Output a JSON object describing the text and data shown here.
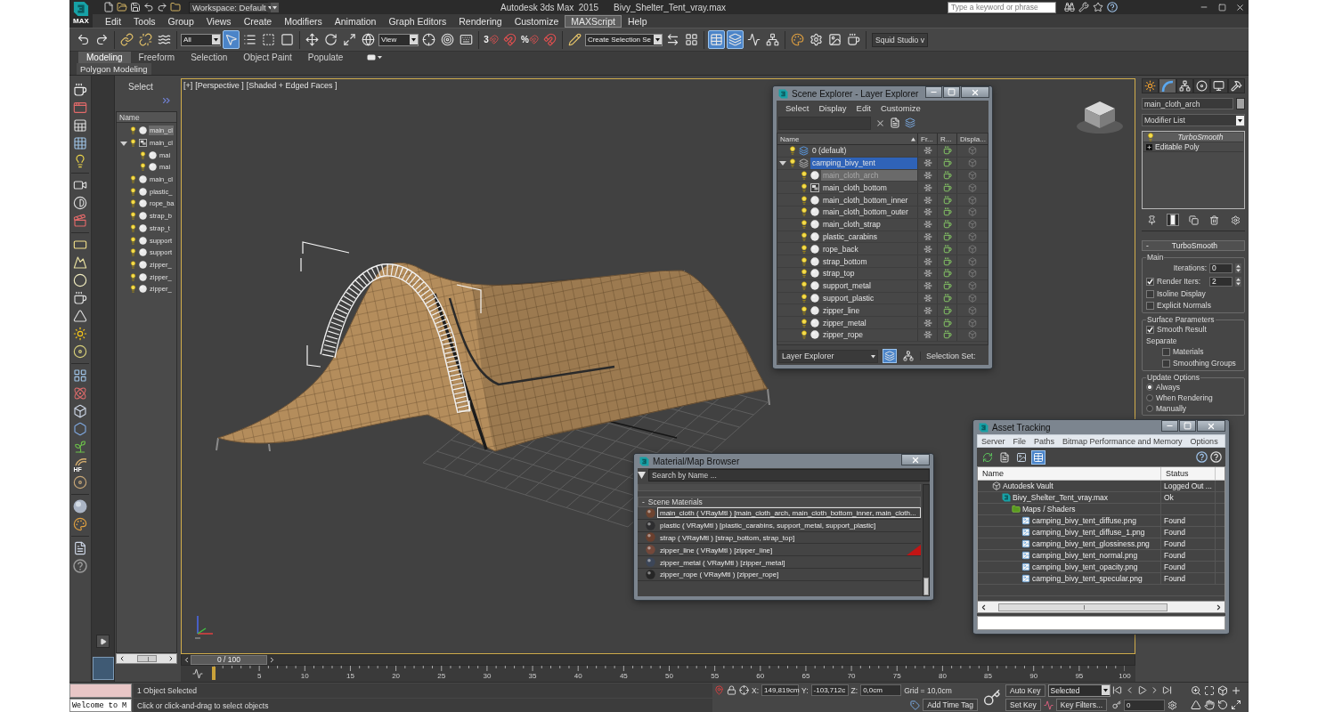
{
  "title_bar": {
    "logo_text": "MAX",
    "workspace": "Workspace: Default",
    "app_title": "Autodesk 3ds Max  2015",
    "file_name": "Bivy_Shelter_Tent_vray.max",
    "search": {
      "placeholder": "Type a keyword or phrase"
    }
  },
  "menu": [
    {
      "label": "Edit",
      "selected": false
    },
    {
      "label": "Tools",
      "selected": false
    },
    {
      "label": "Group",
      "selected": false
    },
    {
      "label": "Views",
      "selected": false
    },
    {
      "label": "Create",
      "selected": false
    },
    {
      "label": "Modifiers",
      "selected": false
    },
    {
      "label": "Animation",
      "selected": false
    },
    {
      "label": "Graph Editors",
      "selected": false
    },
    {
      "label": "Rendering",
      "selected": false
    },
    {
      "label": "Customize",
      "selected": false
    },
    {
      "label": "MAXScript",
      "selected": true
    },
    {
      "label": "Help",
      "selected": false
    }
  ],
  "main_toolbar": [
    {
      "kind": "undo",
      "pressed": false
    },
    {
      "kind": "redo",
      "pressed": false
    },
    {
      "kind": "separator"
    },
    {
      "kind": "link",
      "pressed": false
    },
    {
      "kind": "unlink",
      "pressed": false
    },
    {
      "kind": "bind",
      "pressed": false
    },
    {
      "kind": "separator"
    },
    {
      "kind": "dropdown",
      "value": "All"
    },
    {
      "kind": "select",
      "pressed": true
    },
    {
      "kind": "select_by_name",
      "pressed": false
    },
    {
      "kind": "region",
      "pressed": false
    },
    {
      "kind": "window",
      "pressed": false
    },
    {
      "kind": "separator"
    },
    {
      "kind": "move",
      "pressed": false
    },
    {
      "kind": "rotate",
      "pressed": false
    },
    {
      "kind": "scale",
      "pressed": false
    },
    {
      "kind": "place",
      "pressed": false
    },
    {
      "kind": "dropdown",
      "value": "View"
    },
    {
      "kind": "pivot",
      "pressed": false
    },
    {
      "kind": "manipulate",
      "pressed": false
    },
    {
      "kind": "keyboard",
      "pressed": false
    },
    {
      "kind": "separator"
    },
    {
      "kind": "snap",
      "label": "3",
      "pressed": false
    },
    {
      "kind": "angle_snap",
      "pressed": false
    },
    {
      "kind": "snap",
      "label": "%",
      "pressed": false
    },
    {
      "kind": "spinner_snap",
      "pressed": false
    },
    {
      "kind": "separator"
    },
    {
      "kind": "named_selection",
      "pressed": false
    },
    {
      "kind": "dropdown",
      "value": "Create Selection Se"
    },
    {
      "kind": "mirror",
      "pressed": false
    },
    {
      "kind": "align",
      "pressed": false
    },
    {
      "kind": "separator"
    },
    {
      "kind": "scene_explorer",
      "pressed": true
    },
    {
      "kind": "layer_explorer",
      "pressed": true
    },
    {
      "kind": "curve_editor",
      "pressed": false
    },
    {
      "kind": "schematic",
      "pressed": false
    },
    {
      "kind": "separator"
    },
    {
      "kind": "material_editor",
      "pressed": false
    },
    {
      "kind": "render_setup",
      "pressed": false
    },
    {
      "kind": "rendered_frame",
      "pressed": false
    },
    {
      "kind": "render",
      "pressed": false
    },
    {
      "kind": "separator"
    },
    {
      "kind": "label",
      "value": "Squid Studio v"
    }
  ],
  "ribbon": {
    "tabs": [
      {
        "label": "Modeling",
        "selected": true
      },
      {
        "label": "Freeform",
        "selected": false
      },
      {
        "label": "Selection",
        "selected": false
      },
      {
        "label": "Object Paint",
        "selected": false
      },
      {
        "label": "Populate",
        "selected": false
      }
    ],
    "panel_title": "Polygon Modeling"
  },
  "command_toolbar": {
    "hair_label": "HF"
  },
  "scene_panel": {
    "title": "Select",
    "column": "Name",
    "rows": [
      {
        "name": "main_cl",
        "kind": "object",
        "selected": true
      },
      {
        "name": "main_cl",
        "kind": "group",
        "selected": false,
        "expanded": true,
        "children": [
          {
            "name": "mai",
            "kind": "object",
            "selected": false
          },
          {
            "name": "mai",
            "kind": "object",
            "selected": false
          }
        ]
      },
      {
        "name": "main_cl",
        "kind": "object",
        "selected": false
      },
      {
        "name": "plastic_",
        "kind": "object",
        "selected": false
      },
      {
        "name": "rope_ba",
        "kind": "object",
        "selected": false
      },
      {
        "name": "strap_b",
        "kind": "object",
        "selected": false
      },
      {
        "name": "strap_t",
        "kind": "object",
        "selected": false
      },
      {
        "name": "support",
        "kind": "object",
        "selected": false
      },
      {
        "name": "support",
        "kind": "object",
        "selected": false
      },
      {
        "name": "zipper_",
        "kind": "object",
        "selected": false
      },
      {
        "name": "zipper_",
        "kind": "object",
        "selected": false
      },
      {
        "name": "zipper_",
        "kind": "object",
        "selected": false
      }
    ]
  },
  "viewport": {
    "active": true,
    "labels": [
      "[+]",
      "[Perspective ]",
      "[Shaded + Edged Faces ]"
    ]
  },
  "scene_explorer": {
    "title": "Scene Explorer - Layer Explorer",
    "menu": [
      "Select",
      "Display",
      "Edit",
      "Customize"
    ],
    "columns": [
      {
        "label": "Name",
        "sorted": true
      },
      {
        "label": "Fr...",
        "sorted": false
      },
      {
        "label": "R...",
        "sorted": false
      },
      {
        "label": "Displa...",
        "sorted": false
      }
    ],
    "layers": [
      {
        "name": "0 (default)",
        "kind": "layer",
        "current": true,
        "selected": false
      },
      {
        "name": "camping_bivy_tent",
        "kind": "layer",
        "current": false,
        "selected": true,
        "expanded": true,
        "children": [
          {
            "name": "main_cloth_arch",
            "kind": "object",
            "selected": true
          },
          {
            "name": "main_cloth_bottom",
            "kind": "group",
            "selected": false
          },
          {
            "name": "main_cloth_bottom_inner",
            "kind": "object",
            "selected": false
          },
          {
            "name": "main_cloth_bottom_outer",
            "kind": "object",
            "selected": false
          },
          {
            "name": "main_cloth_strap",
            "kind": "object",
            "selected": false
          },
          {
            "name": "plastic_carabins",
            "kind": "object",
            "selected": false
          },
          {
            "name": "rope_back",
            "kind": "object",
            "selected": false
          },
          {
            "name": "strap_bottom",
            "kind": "object",
            "selected": false
          },
          {
            "name": "strap_top",
            "kind": "object",
            "selected": false
          },
          {
            "name": "support_metal",
            "kind": "object",
            "selected": false
          },
          {
            "name": "support_plastic",
            "kind": "object",
            "selected": false
          },
          {
            "name": "zipper_line",
            "kind": "object",
            "selected": false
          },
          {
            "name": "zipper_metal",
            "kind": "object",
            "selected": false
          },
          {
            "name": "zipper_rope",
            "kind": "object",
            "selected": false
          }
        ]
      }
    ],
    "footer": {
      "mode": "Layer Explorer",
      "view_buttons": [
        {
          "kind": "layers",
          "pressed": true
        },
        {
          "kind": "hierarchy",
          "pressed": false
        }
      ],
      "selection_set": "Selection Set:"
    }
  },
  "material_browser": {
    "title": "Material/Map Browser",
    "search": {
      "placeholder": "Search by Name ..."
    },
    "group": {
      "toggle": "-",
      "label": "Scene Materials"
    },
    "materials": [
      {
        "label": "main_cloth ( VRayMtl ) [main_cloth_arch, main_cloth_bottom_inner, main_cloth...",
        "color": "#6e4430",
        "selected": true,
        "in_viewport": false
      },
      {
        "label": "plastic ( VRayMtl ) [plastic_carabins, support_metal, support_plastic]",
        "color": "#2e2e30",
        "selected": false,
        "in_viewport": false
      },
      {
        "label": "strap ( VRayMtl ) [strap_bottom, strap_top]",
        "color": "#6a3f2e",
        "selected": false,
        "in_viewport": false
      },
      {
        "label": "zipper_line ( VRayMtl ) [zipper_line]",
        "color": "#73483a",
        "selected": false,
        "in_viewport": true
      },
      {
        "label": "zipper_metal ( VRayMtl ) [zipper_metal]",
        "color": "#3c4658",
        "selected": false,
        "in_viewport": false
      },
      {
        "label": "zipper_rope ( VRayMtl ) [zipper_rope]",
        "color": "#262626",
        "selected": false,
        "in_viewport": false
      }
    ]
  },
  "asset_tracking": {
    "title": "Asset Tracking",
    "menu": [
      "Server",
      "File",
      "Paths",
      "Bitmap Performance and Memory",
      "Options"
    ],
    "view_buttons": [
      {
        "kind": "refresh",
        "pressed": false
      },
      {
        "kind": "list",
        "pressed": false
      },
      {
        "kind": "thumbnails",
        "pressed": false
      },
      {
        "kind": "table",
        "pressed": true
      }
    ],
    "columns": [
      "Name",
      "Status"
    ],
    "assets": [
      {
        "name": "Autodesk Vault",
        "status": "Logged Out ...",
        "kind": "vault",
        "children": [
          {
            "name": "Bivy_Shelter_Tent_vray.max",
            "status": "Ok",
            "kind": "scene",
            "children": [
              {
                "name": "Maps / Shaders",
                "kind": "folder",
                "children": [
                  {
                    "name": "camping_bivy_tent_diffuse.png",
                    "status": "Found",
                    "kind": "bitmap"
                  },
                  {
                    "name": "camping_bivy_tent_diffuse_1.png",
                    "status": "Found",
                    "kind": "bitmap"
                  },
                  {
                    "name": "camping_bivy_tent_glossiness.png",
                    "status": "Found",
                    "kind": "bitmap"
                  },
                  {
                    "name": "camping_bivy_tent_normal.png",
                    "status": "Found",
                    "kind": "bitmap"
                  },
                  {
                    "name": "camping_bivy_tent_opacity.png",
                    "status": "Found",
                    "kind": "bitmap"
                  },
                  {
                    "name": "camping_bivy_tent_specular.png",
                    "status": "Found",
                    "kind": "bitmap"
                  }
                ]
              }
            ]
          }
        ]
      }
    ]
  },
  "command_panel": {
    "tabs": [
      {
        "kind": "create",
        "selected": false
      },
      {
        "kind": "modify",
        "selected": true
      },
      {
        "kind": "hierarchy",
        "selected": false
      },
      {
        "kind": "motion",
        "selected": false
      },
      {
        "kind": "display",
        "selected": false
      },
      {
        "kind": "utilities",
        "selected": false
      }
    ],
    "object": {
      "name": "main_cloth_arch",
      "color": "#a3a3a3"
    },
    "modifier_list": "Modifier List",
    "stack": [
      {
        "name": "TurboSmooth",
        "kind": "modifier",
        "selected": true
      },
      {
        "name": "Editable Poly",
        "kind": "base",
        "selected": false
      }
    ],
    "stack_tools": [
      {
        "kind": "pin",
        "pressed": false
      },
      {
        "kind": "end_result",
        "pressed": true
      },
      {
        "kind": "make_unique",
        "pressed": false
      },
      {
        "kind": "remove",
        "pressed": false
      },
      {
        "kind": "configure",
        "pressed": false
      }
    ],
    "rollout": {
      "toggle": "-",
      "title": "TurboSmooth",
      "groups": [
        {
          "title": "Main",
          "controls": [
            {
              "kind": "spinner",
              "label": "Iterations:",
              "value": "0"
            },
            {
              "kind": "check_spinner",
              "label": "Render Iters:",
              "value": "2",
              "checked": true
            },
            {
              "kind": "checkbox",
              "label": "Isoline Display",
              "checked": false
            },
            {
              "kind": "checkbox",
              "label": "Explicit Normals",
              "checked": false
            }
          ]
        },
        {
          "title": "Surface Parameters",
          "controls": [
            {
              "kind": "checkbox",
              "label": "Smooth Result",
              "checked": true
            },
            {
              "kind": "label",
              "label": "Separate",
              "children": [
                {
                  "kind": "checkbox",
                  "label": "Materials",
                  "checked": false
                },
                {
                  "kind": "checkbox",
                  "label": "Smoothing Groups",
                  "checked": false
                }
              ]
            }
          ]
        },
        {
          "title": "Update Options",
          "controls": [
            {
              "kind": "radio",
              "label": "Always",
              "selected": true
            },
            {
              "kind": "radio",
              "label": "When Rendering",
              "selected": false
            },
            {
              "kind": "radio",
              "label": "Manually",
              "selected": false
            }
          ]
        }
      ]
    }
  },
  "timeline": {
    "frame_slider": {
      "label": "0 / 100",
      "level": 0
    },
    "ticks": [
      "5",
      "10",
      "15",
      "20",
      "25",
      "30",
      "35",
      "40",
      "45",
      "50",
      "55",
      "60",
      "65",
      "70",
      "75",
      "80",
      "85",
      "90",
      "95",
      "100"
    ]
  },
  "status_bar": {
    "listener_output": "Welcome to M",
    "prompt": "1 Object Selected",
    "hint": "Click or click-and-drag to select objects",
    "coordinates": [
      {
        "axis": "X:",
        "value": "149,819cm"
      },
      {
        "axis": "Y:",
        "value": "-103,712c"
      },
      {
        "axis": "Z:",
        "value": "0,0cm"
      }
    ],
    "grid": "Grid = 10,0cm",
    "time_tag": "Add Time Tag",
    "auto_key": {
      "label": "Auto Key",
      "on": false
    },
    "key_mode": "Selected",
    "set_key": "Set Key",
    "key_filters": "Key Filters...",
    "current_frame": "0"
  }
}
